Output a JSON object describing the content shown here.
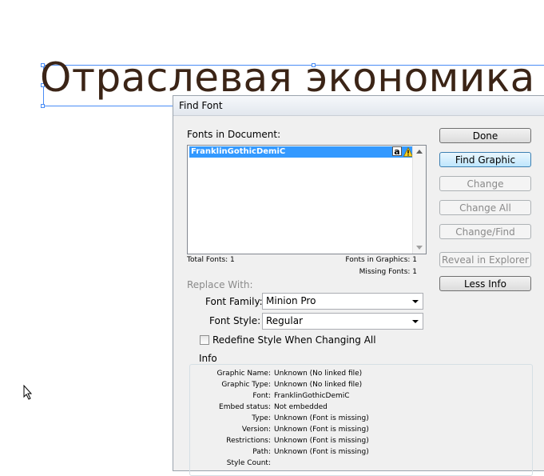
{
  "document": {
    "heading": "Отраслевая экономика"
  },
  "dialog": {
    "title": "Find Font",
    "fonts_label": "Fonts in Document:",
    "font_list": [
      {
        "name": "FranklinGothicDemiC",
        "status_icon": "warning-icon",
        "type_icon": "font-type-icon",
        "type_glyph": "a"
      }
    ],
    "total_fonts": "Total Fonts: 1",
    "fonts_in_graphics": "Fonts in Graphics: 1",
    "missing_fonts": "Missing Fonts: 1",
    "replace_with": "Replace With:",
    "font_family_label": "Font Family:",
    "font_family_value": "Minion Pro",
    "font_style_label": "Font Style:",
    "font_style_value": "Regular",
    "redefine_label": "Redefine Style When Changing All",
    "buttons": {
      "done": "Done",
      "find_graphic": "Find Graphic",
      "change": "Change",
      "change_all": "Change All",
      "change_find": "Change/Find",
      "reveal": "Reveal in Explorer",
      "less_info": "Less Info"
    },
    "info": {
      "title": "Info",
      "rows": [
        {
          "key": "Graphic Name:",
          "value": "Unknown (No linked file)"
        },
        {
          "key": "Graphic Type:",
          "value": "Unknown (No linked file)"
        },
        {
          "key": "Font:",
          "value": "FranklinGothicDemiC"
        },
        {
          "key": "Embed status:",
          "value": "Not embedded"
        },
        {
          "key": "Type:",
          "value": "Unknown (Font is missing)"
        },
        {
          "key": "Version:",
          "value": "Unknown (Font is missing)"
        },
        {
          "key": "Restrictions:",
          "value": "Unknown (Font is missing)"
        },
        {
          "key": "Path:",
          "value": "Unknown (Font is missing)"
        },
        {
          "key": "Style Count:",
          "value": ""
        }
      ]
    }
  },
  "colors": {
    "selection": "#3399ff",
    "heading": "#3b2416",
    "frame": "#4a8df5"
  }
}
